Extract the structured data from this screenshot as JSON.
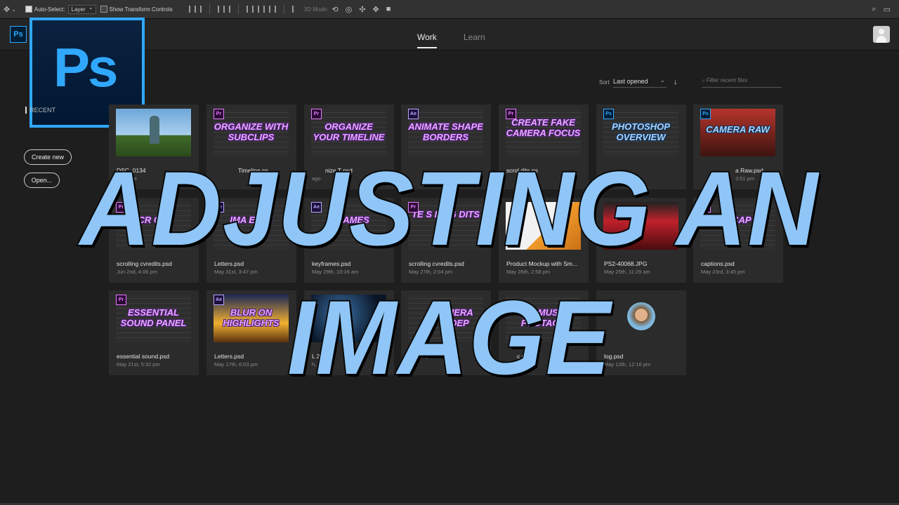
{
  "options_bar": {
    "auto_select_label": "Auto-Select:",
    "layer_select": "Layer",
    "transform_label": "Show Transform Controls",
    "mode_3d_label": "3D Mode:"
  },
  "header": {
    "app_logo": "Ps",
    "tabs": [
      {
        "label": "Work"
      },
      {
        "label": "Learn"
      }
    ]
  },
  "sidebar": {
    "recent_label": "RECENT",
    "create_new": "Create new",
    "open": "Open..."
  },
  "sort": {
    "label": "Sort",
    "value": "Last opened",
    "filter_placeholder": "Filter recent files"
  },
  "files": [
    {
      "name": "DSC_0134",
      "date": "23 minut",
      "app": "",
      "overlay": ""
    },
    {
      "name": "Timeline.ps",
      "date": "",
      "app": "Pr",
      "overlay": "ORGANIZE WITH SUBCLIPS"
    },
    {
      "name": "nize T psd",
      "date": "ago",
      "app": "Pr",
      "overlay": "ORGANIZE YOUR TIMELINE"
    },
    {
      "name": "",
      "date": "",
      "app": "Ae",
      "overlay": "ANIMATE SHAPE BORDERS"
    },
    {
      "name": "scrol dits.ps",
      "date": "",
      "app": "Pr",
      "overlay": "CREATE FAKE CAMERA FOCUS"
    },
    {
      "name": "",
      "date": "",
      "app": "Ps",
      "overlay": "PHOTOSHOP OVERVIEW"
    },
    {
      "name": "a Raw.psd",
      "date": "3:51 pm",
      "app": "Ps",
      "overlay": "CAMERA RAW"
    },
    {
      "name": "scrolling cvredits.psd",
      "date": "Jun 2nd, 4:06 pm",
      "app": "Pr",
      "overlay": "CR GIF"
    },
    {
      "name": "Letters.psd",
      "date": "May 31st, 3:47 pm",
      "app": "Ae",
      "overlay": "IMA ETTE"
    },
    {
      "name": "keyframes.psd",
      "date": "May 29th, 10:16 am",
      "app": "Ae",
      "overlay": "T RAMES"
    },
    {
      "name": "scrolling cvredits.psd",
      "date": "May 27th, 2:04 pm",
      "app": "Pr",
      "overlay": "TE S LING DITS"
    },
    {
      "name": "Product Mockup with Sm...",
      "date": "May 26th, 2:58 pm",
      "app": "",
      "overlay": ""
    },
    {
      "name": "PS2-40068.JPG",
      "date": "May 25th, 11:29 am",
      "app": "",
      "overlay": ""
    },
    {
      "name": "captions.psd",
      "date": "May 23rd, 3:45 pm",
      "app": "Pr",
      "overlay": "CR CAP S"
    },
    {
      "name": "essential sound.psd",
      "date": "May 21st, 5:32 pm",
      "app": "Pr",
      "overlay": "ESSENTIAL SOUND PANEL"
    },
    {
      "name": "Letters.psd",
      "date": "May 17th, 6:03 pm",
      "app": "Ae",
      "overlay": "BLUR ON HIGHLIGHTS"
    },
    {
      "name": "L 2-",
      "date": "h, 4",
      "app": "",
      "overlay": ""
    },
    {
      "name": "era-",
      "date": "",
      "app": "",
      "overlay": "MERA DEP"
    },
    {
      "name": "c rem",
      "date": "13th",
      "app": "",
      "overlay": "MIX MUSIC FOOTAGE"
    },
    {
      "name": "log.psd",
      "date": "May 12th, 12:16 pm",
      "app": "",
      "overlay": ""
    }
  ],
  "overlay_title": {
    "line1": "ADJUSTING AN",
    "line2": "IMAGE"
  },
  "colors": {
    "accent": "#31a8ff",
    "title_fill": "#8fc6f7",
    "overlay_text": "#e8a8ff"
  }
}
